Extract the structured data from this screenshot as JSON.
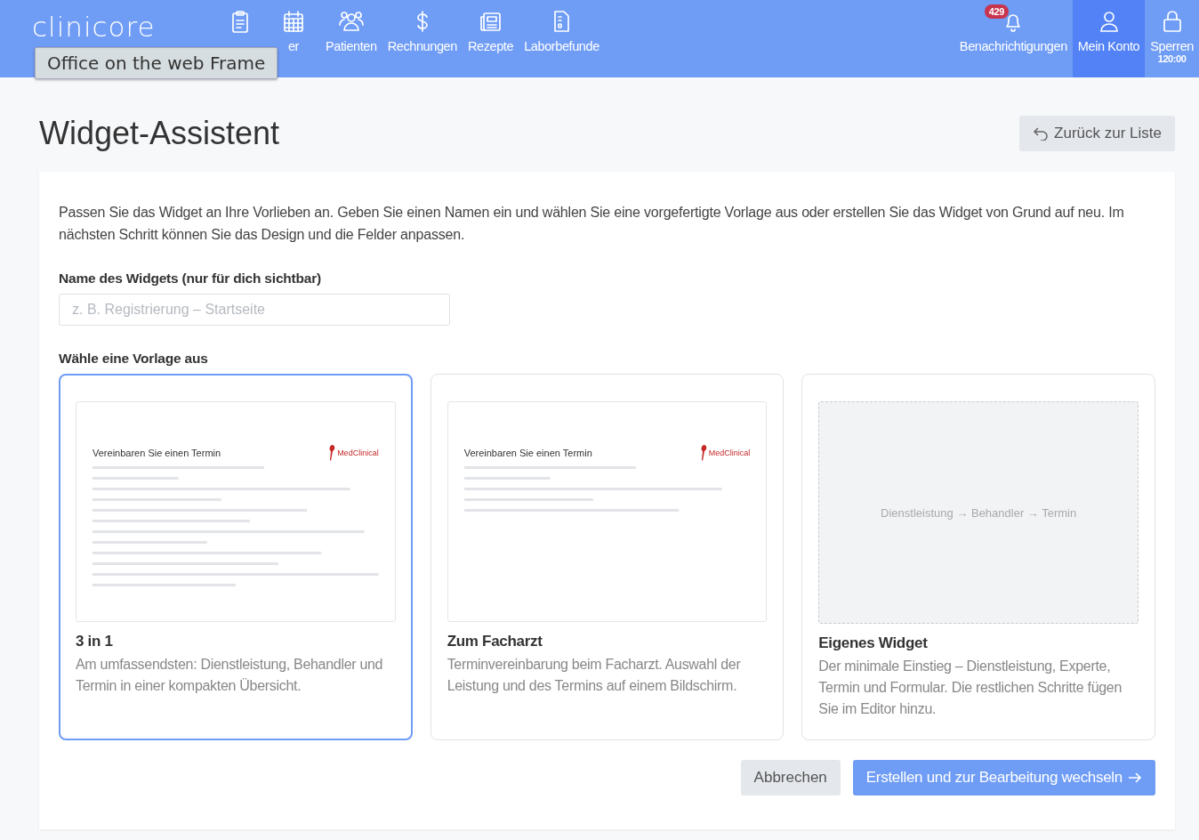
{
  "topbar": {
    "logo": "clinicore",
    "nav": [
      {
        "label": "er"
      },
      {
        "label": "Patienten"
      },
      {
        "label": "Rechnungen"
      },
      {
        "label": "Rezepte"
      },
      {
        "label": "Laborbefunde"
      }
    ],
    "right": [
      {
        "label": "Benachrichtigungen",
        "badge": "429",
        "selected": false
      },
      {
        "label": "Mein Konto",
        "selected": true
      },
      {
        "label": "Sperren",
        "sub": "120:00",
        "selected": false
      }
    ],
    "tooltip": "Office on the web Frame"
  },
  "page": {
    "title": "Widget-Assistent",
    "back_button": "Zurück zur Liste"
  },
  "form": {
    "intro": "Passen Sie das Widget an Ihre Vorlieben an. Geben Sie einen Namen ein und wählen Sie eine vorgefertigte Vorlage aus oder erstellen Sie das Widget von Grund auf neu. Im nächsten Schritt können Sie das Design und die Felder anpassen.",
    "name_label": "Name des Widgets (nur für dich sichtbar)",
    "name_placeholder": "z. B. Registrierung – Startseite",
    "template_label": "Wähle eine Vorlage aus",
    "templates": [
      {
        "kind": "full",
        "selected": true,
        "preview_title": "Vereinbaren Sie einen Termin",
        "preview_brand": "MedClinical",
        "title": "3 in 1",
        "description": "Am umfassendsten: Dienstleistung, Behandler und Termin in einer kompakten Übersicht."
      },
      {
        "kind": "compact",
        "selected": false,
        "preview_title": "Vereinbaren Sie einen Termin",
        "preview_brand": "MedClinical",
        "title": "Zum Facharzt",
        "description": "Terminvereinbarung beim Facharzt. Auswahl der Leistung und des Termins auf einem Bildschirm."
      },
      {
        "kind": "custom",
        "selected": false,
        "preview_title": "Dienstleistung → Behandler → Termin",
        "title": "Eigenes Widget",
        "description": "Der minimale Einstieg – Dienstleistung, Experte, Termin und Formular. Die restlichen Schritte fügen Sie im Editor hinzu."
      }
    ],
    "cancel": "Abbrechen",
    "submit": "Erstellen und zur Bearbeitung wechseln"
  }
}
